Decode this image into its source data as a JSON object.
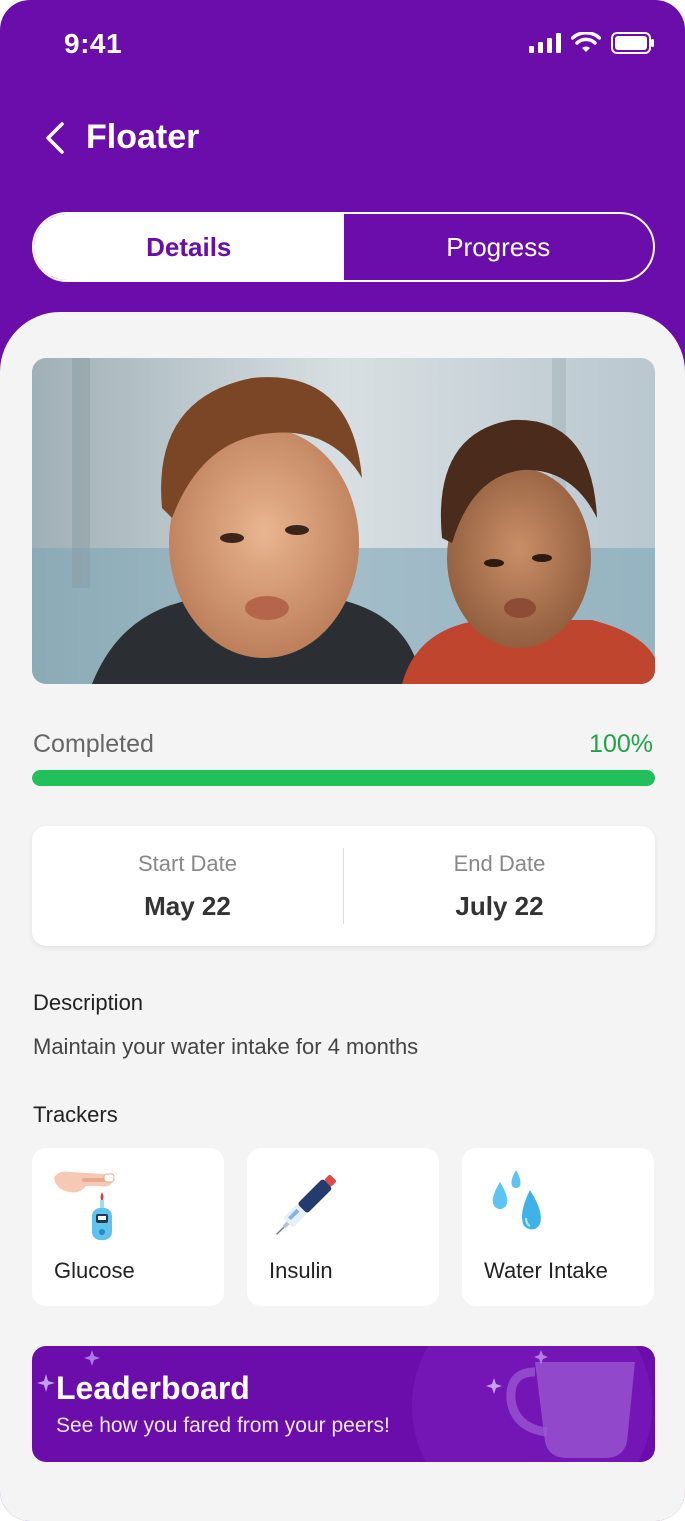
{
  "status_bar": {
    "time": "9:41"
  },
  "header": {
    "title": "Floater"
  },
  "tabs": [
    {
      "label": "Details",
      "active": true
    },
    {
      "label": "Progress",
      "active": false
    }
  ],
  "progress": {
    "label": "Completed",
    "value_text": "100%",
    "fraction": 1.0
  },
  "dates": {
    "start_label": "Start Date",
    "start_value": "May 22",
    "end_label": "End Date",
    "end_value": "July 22"
  },
  "description": {
    "heading": "Description",
    "text": "Maintain your water intake for 4 months"
  },
  "trackers": {
    "heading": "Trackers",
    "items": [
      {
        "label": "Glucose",
        "icon": "glucose-meter-icon"
      },
      {
        "label": "Insulin",
        "icon": "insulin-pen-icon"
      },
      {
        "label": "Water Intake",
        "icon": "water-drops-icon"
      }
    ]
  },
  "leaderboard": {
    "title": "Leaderboard",
    "subtitle": "See how you fared from your peers!",
    "icon": "trophy-cup-icon"
  },
  "colors": {
    "brand": "#6a0dab",
    "success": "#22c05a",
    "background": "#f4f4f4"
  }
}
